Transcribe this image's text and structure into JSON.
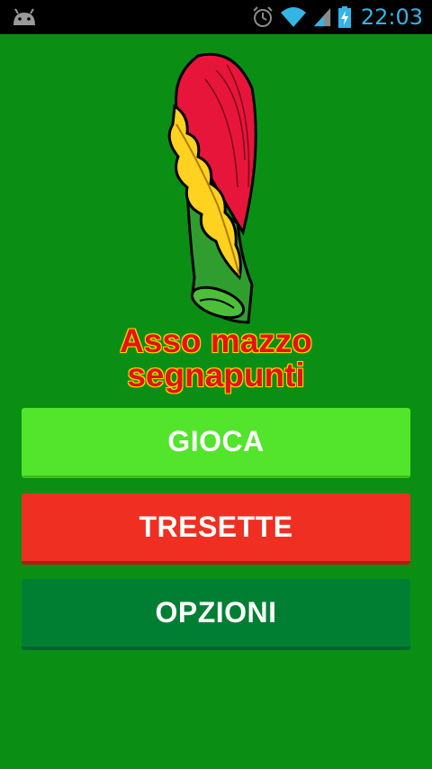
{
  "statusbar": {
    "time": "22:03",
    "icons": [
      "android-icon",
      "alarm-icon",
      "wifi-icon",
      "signal-icon",
      "battery-charging-icon"
    ],
    "accent_color": "#33b5e5"
  },
  "app": {
    "logo": "asso-di-bastoni-logo",
    "title_line1": "Asso mazzo",
    "title_line2": "segnapunti",
    "background_color": "#0a8f14"
  },
  "buttons": {
    "gioca": {
      "label": "GIOCA",
      "color": "#52e52b"
    },
    "tresette": {
      "label": "TRESETTE",
      "color": "#ee2f22"
    },
    "opzioni": {
      "label": "OPZIONI",
      "color": "#007f33"
    }
  }
}
